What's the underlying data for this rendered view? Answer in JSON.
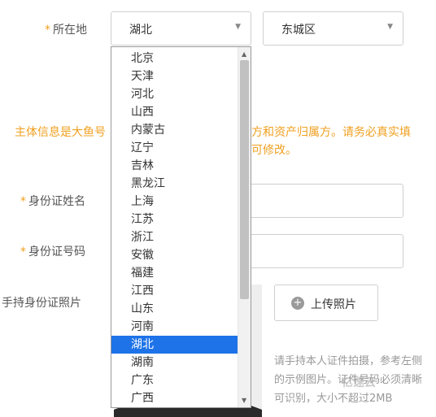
{
  "location": {
    "label": "所在地",
    "province_value": "湖北",
    "district_value": "东城区"
  },
  "notice": {
    "line1_left": "主体信息是大鱼号",
    "line1_right": "方和资产归属方。请务必真实填",
    "line2_right": "可修改。"
  },
  "id_name": {
    "label": "身份证姓名",
    "value": ""
  },
  "id_number": {
    "label": "身份证号码",
    "value": ""
  },
  "id_photo": {
    "label": "手持身份证照片",
    "upload_label": "上传照片",
    "hint": "请手持本人证件拍摄，参考左侧的示例图片。证件号码必须清晰可识别，大小不超过2MB"
  },
  "watermark": "亿速云",
  "dropdown": {
    "options": [
      "北京",
      "天津",
      "河北",
      "山西",
      "内蒙古",
      "辽宁",
      "吉林",
      "黑龙江",
      "上海",
      "江苏",
      "浙江",
      "安徽",
      "福建",
      "江西",
      "山东",
      "河南",
      "湖北",
      "湖南",
      "广东",
      "广西"
    ],
    "selected": "湖北"
  }
}
